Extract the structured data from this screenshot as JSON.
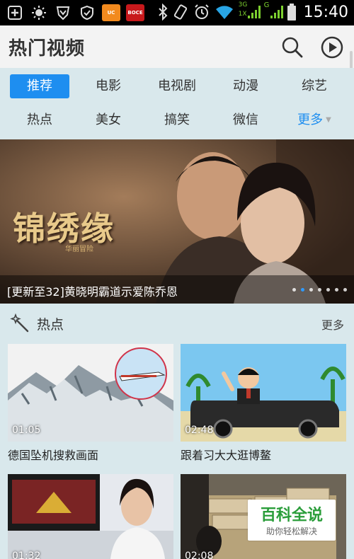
{
  "status_bar": {
    "time": "15:40",
    "app_icon_label": "BOCE",
    "network_3g": "3G",
    "network_1x": "1X",
    "network_g": "G"
  },
  "app_bar": {
    "title": "热门视频"
  },
  "tabs": {
    "row1": [
      {
        "label": "推荐",
        "active": true
      },
      {
        "label": "电影",
        "active": false
      },
      {
        "label": "电视剧",
        "active": false
      },
      {
        "label": "动漫",
        "active": false
      },
      {
        "label": "综艺",
        "active": false
      }
    ],
    "row2": [
      {
        "label": "热点",
        "active": false
      },
      {
        "label": "美女",
        "active": false
      },
      {
        "label": "搞笑",
        "active": false
      },
      {
        "label": "微信",
        "active": false
      },
      {
        "label": "更多",
        "active": false
      }
    ]
  },
  "banner": {
    "title_art": "锦绣缘",
    "title_art_sub": "华丽冒险",
    "caption": "[更新至32]黄晓明霸道示爱陈乔恩",
    "pages": 7,
    "active_page": 1
  },
  "section": {
    "title": "热点",
    "more_label": "更多"
  },
  "videos": [
    {
      "title": "德国坠机搜救画面",
      "duration": "01:05"
    },
    {
      "title": "跟着习大大逛博鳌",
      "duration": "02:48"
    },
    {
      "title": "",
      "duration": "01:32"
    },
    {
      "title": "",
      "duration": "02:08"
    }
  ],
  "watermark": {
    "title": "百科全说",
    "subtitle": "助你轻松解决"
  },
  "colors": {
    "accent": "#1e8ef0",
    "background": "#d9e8ec",
    "status_bar": "#000000"
  }
}
